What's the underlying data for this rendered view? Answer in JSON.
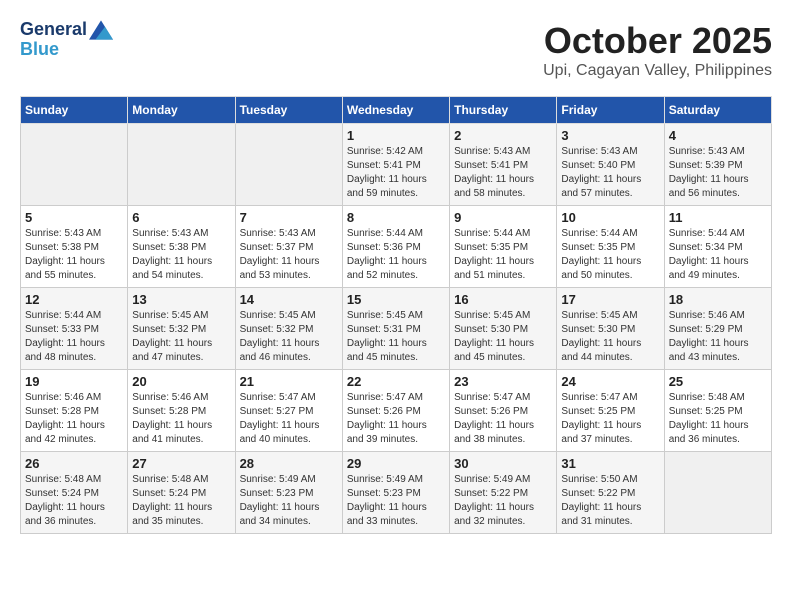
{
  "logo": {
    "line1": "General",
    "line2": "Blue"
  },
  "title": "October 2025",
  "subtitle": "Upi, Cagayan Valley, Philippines",
  "weekdays": [
    "Sunday",
    "Monday",
    "Tuesday",
    "Wednesday",
    "Thursday",
    "Friday",
    "Saturday"
  ],
  "weeks": [
    [
      {
        "day": "",
        "sunrise": "",
        "sunset": "",
        "daylight": ""
      },
      {
        "day": "",
        "sunrise": "",
        "sunset": "",
        "daylight": ""
      },
      {
        "day": "",
        "sunrise": "",
        "sunset": "",
        "daylight": ""
      },
      {
        "day": "1",
        "sunrise": "Sunrise: 5:42 AM",
        "sunset": "Sunset: 5:41 PM",
        "daylight": "Daylight: 11 hours and 59 minutes."
      },
      {
        "day": "2",
        "sunrise": "Sunrise: 5:43 AM",
        "sunset": "Sunset: 5:41 PM",
        "daylight": "Daylight: 11 hours and 58 minutes."
      },
      {
        "day": "3",
        "sunrise": "Sunrise: 5:43 AM",
        "sunset": "Sunset: 5:40 PM",
        "daylight": "Daylight: 11 hours and 57 minutes."
      },
      {
        "day": "4",
        "sunrise": "Sunrise: 5:43 AM",
        "sunset": "Sunset: 5:39 PM",
        "daylight": "Daylight: 11 hours and 56 minutes."
      }
    ],
    [
      {
        "day": "5",
        "sunrise": "Sunrise: 5:43 AM",
        "sunset": "Sunset: 5:38 PM",
        "daylight": "Daylight: 11 hours and 55 minutes."
      },
      {
        "day": "6",
        "sunrise": "Sunrise: 5:43 AM",
        "sunset": "Sunset: 5:38 PM",
        "daylight": "Daylight: 11 hours and 54 minutes."
      },
      {
        "day": "7",
        "sunrise": "Sunrise: 5:43 AM",
        "sunset": "Sunset: 5:37 PM",
        "daylight": "Daylight: 11 hours and 53 minutes."
      },
      {
        "day": "8",
        "sunrise": "Sunrise: 5:44 AM",
        "sunset": "Sunset: 5:36 PM",
        "daylight": "Daylight: 11 hours and 52 minutes."
      },
      {
        "day": "9",
        "sunrise": "Sunrise: 5:44 AM",
        "sunset": "Sunset: 5:35 PM",
        "daylight": "Daylight: 11 hours and 51 minutes."
      },
      {
        "day": "10",
        "sunrise": "Sunrise: 5:44 AM",
        "sunset": "Sunset: 5:35 PM",
        "daylight": "Daylight: 11 hours and 50 minutes."
      },
      {
        "day": "11",
        "sunrise": "Sunrise: 5:44 AM",
        "sunset": "Sunset: 5:34 PM",
        "daylight": "Daylight: 11 hours and 49 minutes."
      }
    ],
    [
      {
        "day": "12",
        "sunrise": "Sunrise: 5:44 AM",
        "sunset": "Sunset: 5:33 PM",
        "daylight": "Daylight: 11 hours and 48 minutes."
      },
      {
        "day": "13",
        "sunrise": "Sunrise: 5:45 AM",
        "sunset": "Sunset: 5:32 PM",
        "daylight": "Daylight: 11 hours and 47 minutes."
      },
      {
        "day": "14",
        "sunrise": "Sunrise: 5:45 AM",
        "sunset": "Sunset: 5:32 PM",
        "daylight": "Daylight: 11 hours and 46 minutes."
      },
      {
        "day": "15",
        "sunrise": "Sunrise: 5:45 AM",
        "sunset": "Sunset: 5:31 PM",
        "daylight": "Daylight: 11 hours and 45 minutes."
      },
      {
        "day": "16",
        "sunrise": "Sunrise: 5:45 AM",
        "sunset": "Sunset: 5:30 PM",
        "daylight": "Daylight: 11 hours and 45 minutes."
      },
      {
        "day": "17",
        "sunrise": "Sunrise: 5:45 AM",
        "sunset": "Sunset: 5:30 PM",
        "daylight": "Daylight: 11 hours and 44 minutes."
      },
      {
        "day": "18",
        "sunrise": "Sunrise: 5:46 AM",
        "sunset": "Sunset: 5:29 PM",
        "daylight": "Daylight: 11 hours and 43 minutes."
      }
    ],
    [
      {
        "day": "19",
        "sunrise": "Sunrise: 5:46 AM",
        "sunset": "Sunset: 5:28 PM",
        "daylight": "Daylight: 11 hours and 42 minutes."
      },
      {
        "day": "20",
        "sunrise": "Sunrise: 5:46 AM",
        "sunset": "Sunset: 5:28 PM",
        "daylight": "Daylight: 11 hours and 41 minutes."
      },
      {
        "day": "21",
        "sunrise": "Sunrise: 5:47 AM",
        "sunset": "Sunset: 5:27 PM",
        "daylight": "Daylight: 11 hours and 40 minutes."
      },
      {
        "day": "22",
        "sunrise": "Sunrise: 5:47 AM",
        "sunset": "Sunset: 5:26 PM",
        "daylight": "Daylight: 11 hours and 39 minutes."
      },
      {
        "day": "23",
        "sunrise": "Sunrise: 5:47 AM",
        "sunset": "Sunset: 5:26 PM",
        "daylight": "Daylight: 11 hours and 38 minutes."
      },
      {
        "day": "24",
        "sunrise": "Sunrise: 5:47 AM",
        "sunset": "Sunset: 5:25 PM",
        "daylight": "Daylight: 11 hours and 37 minutes."
      },
      {
        "day": "25",
        "sunrise": "Sunrise: 5:48 AM",
        "sunset": "Sunset: 5:25 PM",
        "daylight": "Daylight: 11 hours and 36 minutes."
      }
    ],
    [
      {
        "day": "26",
        "sunrise": "Sunrise: 5:48 AM",
        "sunset": "Sunset: 5:24 PM",
        "daylight": "Daylight: 11 hours and 36 minutes."
      },
      {
        "day": "27",
        "sunrise": "Sunrise: 5:48 AM",
        "sunset": "Sunset: 5:24 PM",
        "daylight": "Daylight: 11 hours and 35 minutes."
      },
      {
        "day": "28",
        "sunrise": "Sunrise: 5:49 AM",
        "sunset": "Sunset: 5:23 PM",
        "daylight": "Daylight: 11 hours and 34 minutes."
      },
      {
        "day": "29",
        "sunrise": "Sunrise: 5:49 AM",
        "sunset": "Sunset: 5:23 PM",
        "daylight": "Daylight: 11 hours and 33 minutes."
      },
      {
        "day": "30",
        "sunrise": "Sunrise: 5:49 AM",
        "sunset": "Sunset: 5:22 PM",
        "daylight": "Daylight: 11 hours and 32 minutes."
      },
      {
        "day": "31",
        "sunrise": "Sunrise: 5:50 AM",
        "sunset": "Sunset: 5:22 PM",
        "daylight": "Daylight: 11 hours and 31 minutes."
      },
      {
        "day": "",
        "sunrise": "",
        "sunset": "",
        "daylight": ""
      }
    ]
  ]
}
